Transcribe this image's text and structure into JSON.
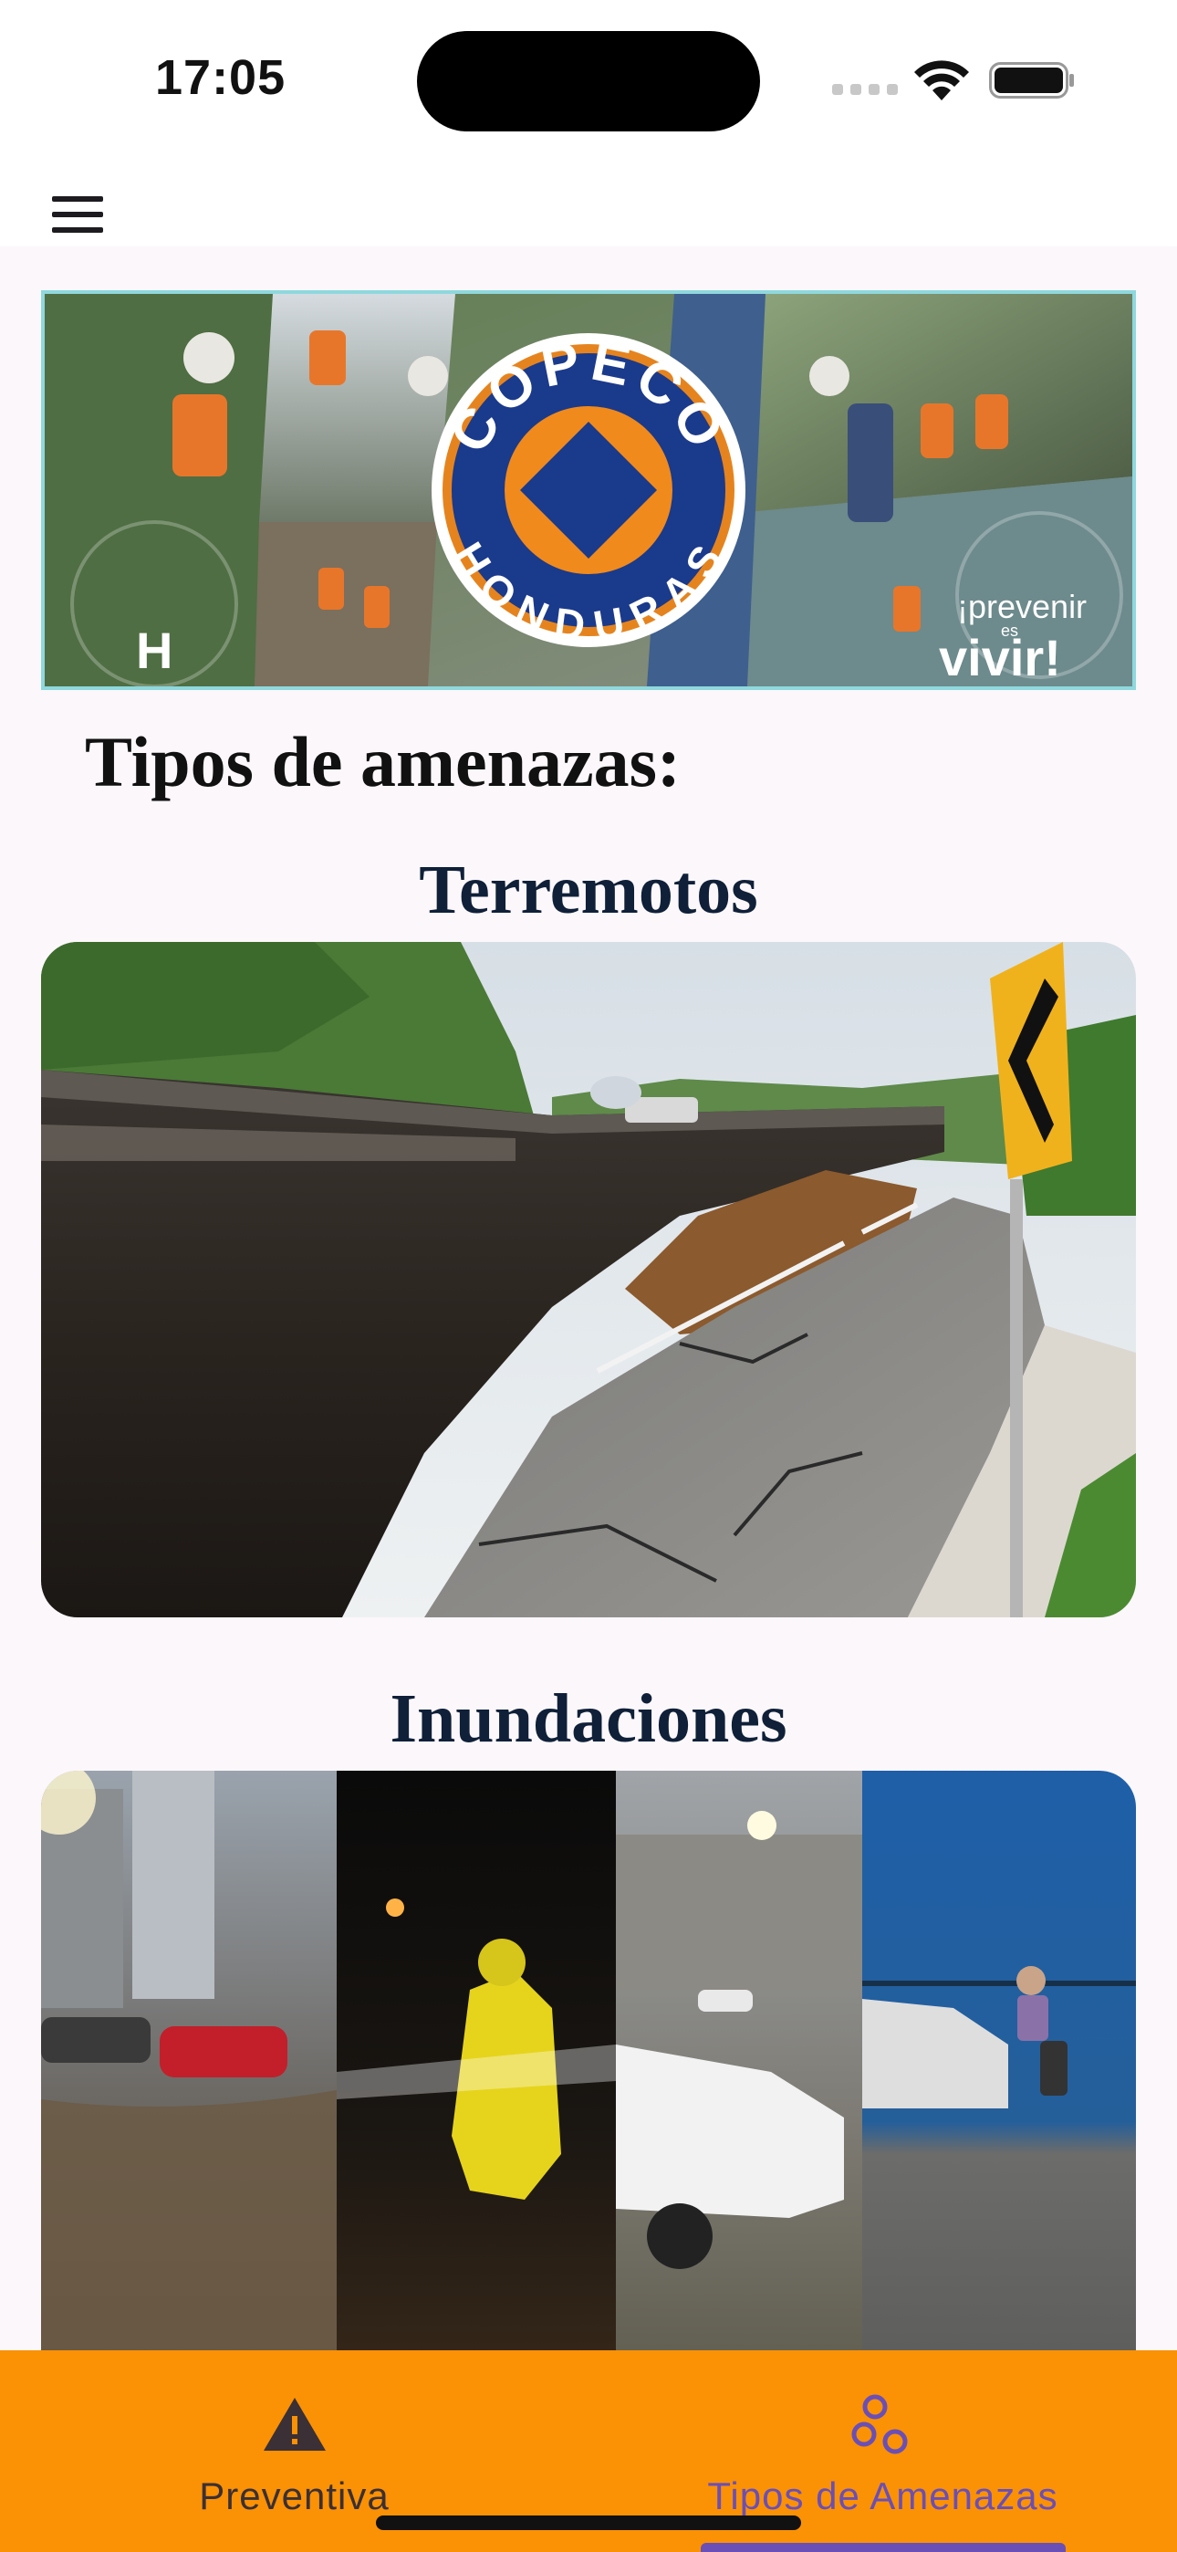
{
  "status_bar": {
    "time": "17:05"
  },
  "app_bar": {
    "menu_icon": "hamburger-menu-icon"
  },
  "banner": {
    "logo_top_text": "COPECO",
    "logo_bottom_text": "HONDURAS",
    "slogan_small": "¡prevenir",
    "slogan_es": "es",
    "slogan_big": "vivir!"
  },
  "main": {
    "section_title": "Tipos de amenazas:",
    "cards": [
      {
        "title": "Terremotos"
      },
      {
        "title": "Inundaciones"
      }
    ]
  },
  "bottom_nav": {
    "items": [
      {
        "label": "Preventiva",
        "icon": "warning-triangle-icon",
        "color": "#3a3035",
        "selected": false
      },
      {
        "label": "Tipos de Amenazas",
        "icon": "hazard-circles-icon",
        "color": "#6a4fb6",
        "selected": true
      }
    ]
  },
  "colors": {
    "nav_background": "#fb9105",
    "accent": "#6a4fb6",
    "title": "#0f2038"
  }
}
